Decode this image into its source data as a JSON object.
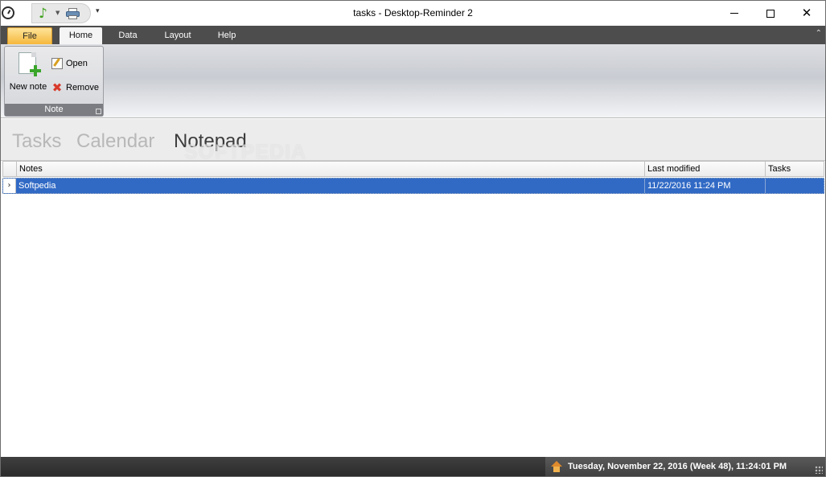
{
  "titlebar": {
    "title": "tasks - Desktop-Reminder 2",
    "qat_customize": "▾"
  },
  "ribbon": {
    "tabs": [
      {
        "label": "File"
      },
      {
        "label": "Home"
      },
      {
        "label": "Data"
      },
      {
        "label": "Layout"
      },
      {
        "label": "Help"
      }
    ],
    "group_note": {
      "caption": "Note",
      "new_note": "New note",
      "open": "Open",
      "remove": "Remove"
    }
  },
  "views": {
    "tasks": "Tasks",
    "calendar": "Calendar",
    "notepad": "Notepad",
    "active": "Notepad"
  },
  "watermark": "SOFTPEDIA",
  "grid": {
    "columns": [
      "Notes",
      "Last modified",
      "Tasks"
    ],
    "rows": [
      {
        "indicator": "›",
        "notes": "Softpedia",
        "last_modified": "11/22/2016 11:24 PM",
        "tasks": ""
      }
    ]
  },
  "statusbar": {
    "datetime": "Tuesday, November 22, 2016 (Week 48), 11:24:01 PM"
  },
  "colors": {
    "accent": "#316ac5",
    "ribbon_dark": "#4d4d4d",
    "file_tab": "#f5b73b"
  },
  "icons": [
    "clock-icon",
    "note-icon",
    "print-icon",
    "newdoc-icon",
    "pencil-icon",
    "x-icon",
    "home-icon"
  ]
}
